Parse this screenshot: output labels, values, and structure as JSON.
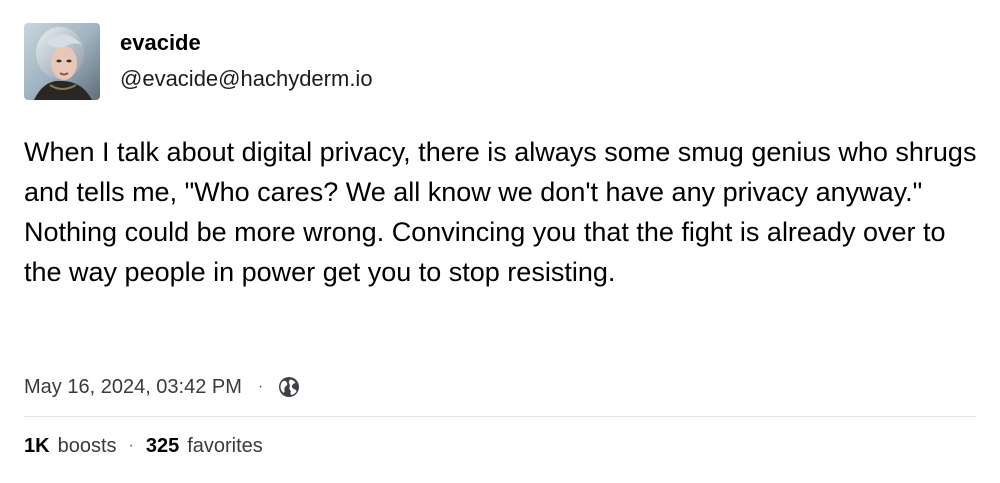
{
  "author": {
    "display_name": "evacide",
    "handle": "@evacide@hachyderm.io",
    "avatar_icon": "avatar-portrait"
  },
  "post": {
    "text": "When I talk about digital privacy, there is always some smug genius who shrugs and tells me, \"Who cares? We all know we don't have any privacy anyway.\" Nothing could be more wrong. Convincing you that the fight is already over to the way people in power get you to stop resisting.",
    "timestamp": "May 16, 2024, 03:42 PM",
    "separator": "·",
    "visibility_icon": "globe-icon"
  },
  "stats": {
    "boosts_count": "1K",
    "boosts_label": "boosts",
    "separator": "·",
    "favorites_count": "325",
    "favorites_label": "favorites"
  },
  "colors": {
    "text": "#000000",
    "secondary_text": "#3a3a3a",
    "divider": "#e3e3e8",
    "background": "#ffffff"
  }
}
